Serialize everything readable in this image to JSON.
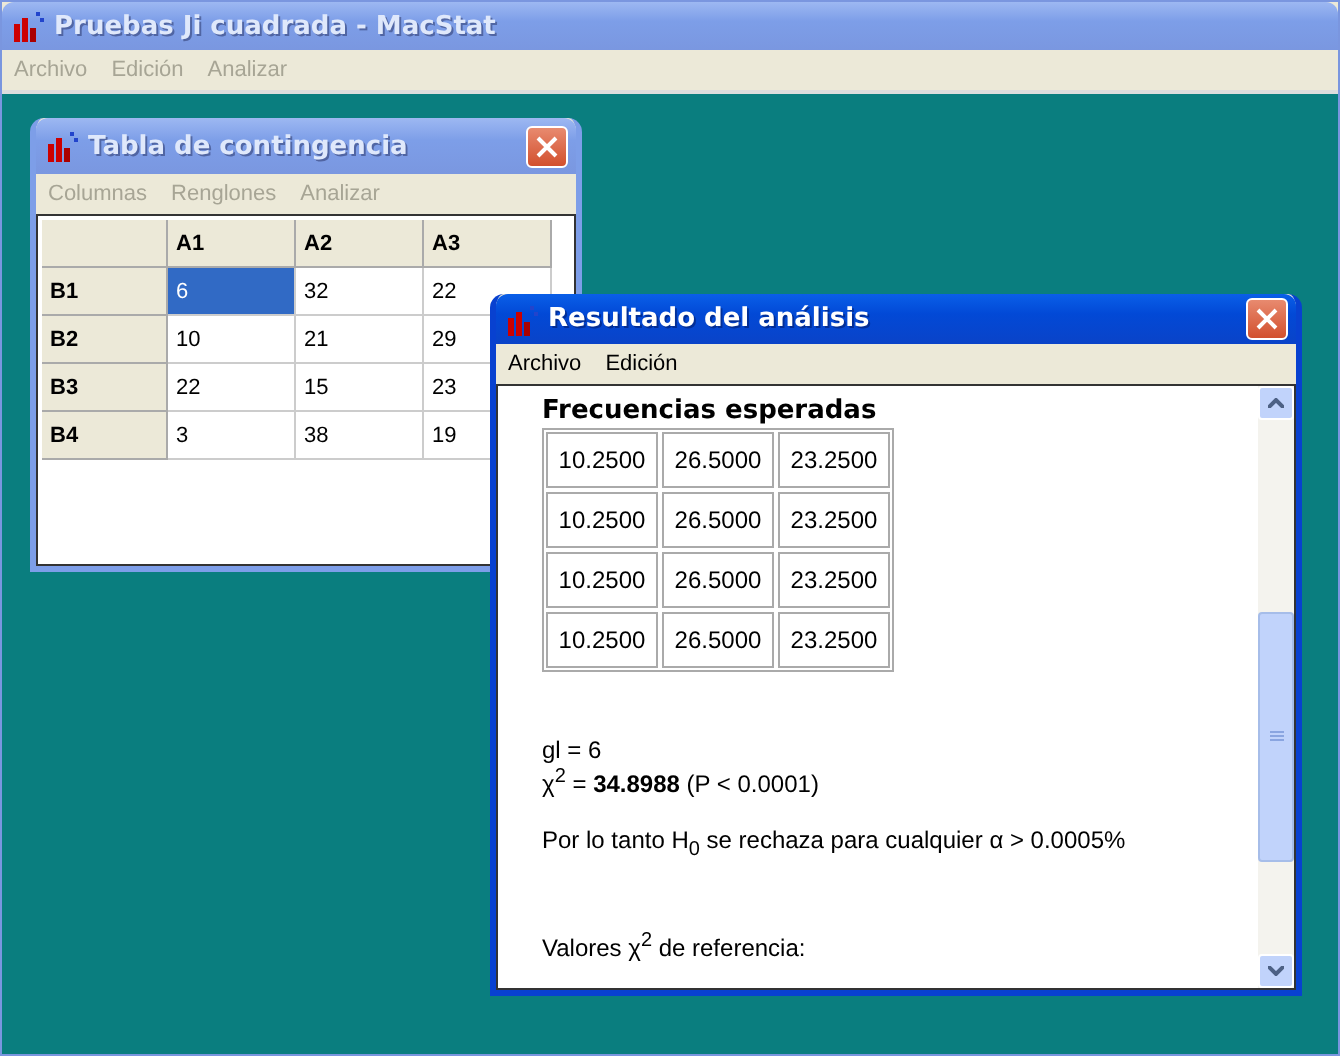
{
  "window": {
    "title": "Pruebas Ji cuadrada - MacStat",
    "active": false
  },
  "menu": [
    {
      "label": "Archivo",
      "disabled": true
    },
    {
      "label": "Edición",
      "disabled": true
    },
    {
      "label": "Analizar",
      "disabled": true
    }
  ],
  "contingency_window": {
    "title": "Tabla de contingencia",
    "active": false,
    "menu": [
      {
        "label": "Columnas",
        "disabled": true
      },
      {
        "label": "Renglones",
        "disabled": true
      },
      {
        "label": "Analizar",
        "disabled": true
      }
    ],
    "columns": [
      "A1",
      "A2",
      "A3"
    ],
    "rows": [
      {
        "label": "B1",
        "cells": [
          {
            "value": "6",
            "selected": true
          },
          {
            "value": "32",
            "selected": false
          },
          {
            "value": "22",
            "selected": false
          }
        ]
      },
      {
        "label": "B2",
        "cells": [
          {
            "value": "10",
            "selected": false
          },
          {
            "value": "21",
            "selected": false
          },
          {
            "value": "29",
            "selected": false
          }
        ]
      },
      {
        "label": "B3",
        "cells": [
          {
            "value": "22",
            "selected": false
          },
          {
            "value": "15",
            "selected": false
          },
          {
            "value": "23",
            "selected": false
          }
        ]
      },
      {
        "label": "B4",
        "cells": [
          {
            "value": "3",
            "selected": false
          },
          {
            "value": "38",
            "selected": false
          },
          {
            "value": "19",
            "selected": false
          }
        ]
      }
    ]
  },
  "result_window": {
    "title": "Resultado del análisis",
    "active": true,
    "menu": [
      {
        "label": "Archivo",
        "disabled": false
      },
      {
        "label": "Edición",
        "disabled": false
      }
    ],
    "heading": "Frecuencias esperadas",
    "expected": [
      [
        "10.2500",
        "26.5000",
        "23.2500"
      ],
      [
        "10.2500",
        "26.5000",
        "23.2500"
      ],
      [
        "10.2500",
        "26.5000",
        "23.2500"
      ],
      [
        "10.2500",
        "26.5000",
        "23.2500"
      ]
    ],
    "lines": [
      "gl = 6",
      "χ$^{2}$ = **34.8988** (P < 0.0001)"
    ],
    "conclusion": "Por lo tanto H$_{0}$ se rechaza para cualquier α > 0.0005%",
    "reference": "Valores χ$^{2}$ de referencia:"
  }
}
